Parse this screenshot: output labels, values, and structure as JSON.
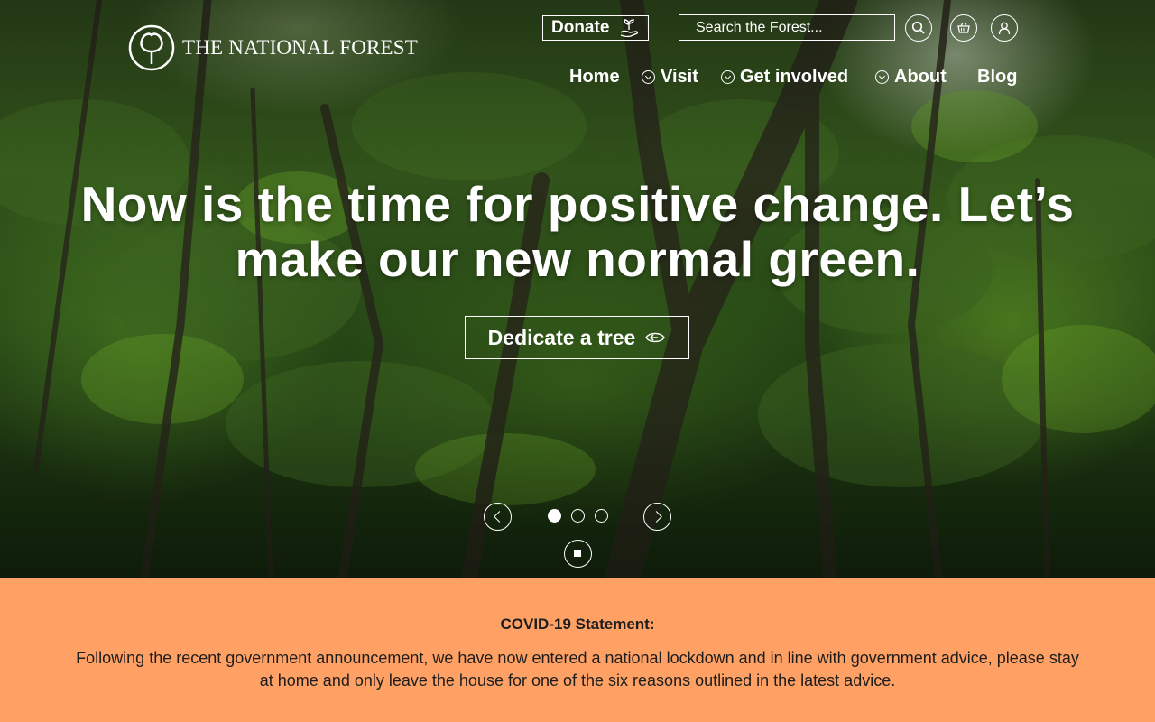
{
  "brand": {
    "name": "THE NATIONAL FOREST",
    "logo_icon": "tree-logo-icon"
  },
  "utility": {
    "donate_label": "Donate",
    "donate_icon": "seedling-hand-icon",
    "search_placeholder": "Search the Forest...",
    "search_icon": "search-icon",
    "basket_icon": "basket-icon",
    "account_icon": "user-icon"
  },
  "nav": {
    "items": [
      {
        "label": "Home",
        "has_dropdown": false
      },
      {
        "label": "Visit",
        "has_dropdown": true
      },
      {
        "label": "Get involved",
        "has_dropdown": true
      },
      {
        "label": "About",
        "has_dropdown": true
      },
      {
        "label": "Blog",
        "has_dropdown": false
      }
    ]
  },
  "hero": {
    "headline_line1": "Now is the time for positive change. Let’s",
    "headline_line2": "make our new normal green.",
    "cta_label": "Dedicate a tree",
    "cta_icon": "arrow-eye-icon",
    "slides_total": 3,
    "active_slide": 1
  },
  "covid": {
    "title": "COVID-19 Statement:",
    "body": "Following the recent government announcement, we have now entered a national lockdown and in line with government advice, please stay at home and only leave the house for one of the six reasons outlined in the latest advice."
  },
  "colors": {
    "banner_bg": "#ffa164",
    "text_light": "#ffffff",
    "text_dark": "#1d1d1d",
    "forest_green": "#2f4a1c"
  }
}
